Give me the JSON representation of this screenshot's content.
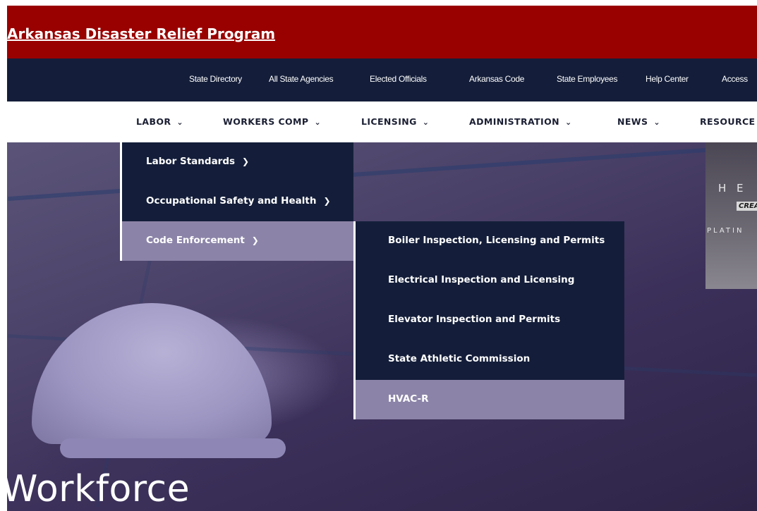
{
  "banner": {
    "link_text": "Arkansas Disaster Relief Program"
  },
  "utility_nav": [
    {
      "label": "State Directory"
    },
    {
      "label": "All State Agencies"
    },
    {
      "label": "Elected Officials"
    },
    {
      "label": "Arkansas Code"
    },
    {
      "label": "State Employees"
    },
    {
      "label": "Help Center"
    },
    {
      "label": "Access"
    }
  ],
  "main_nav": [
    {
      "label": "LABOR",
      "chevron": "chevron-down-icon"
    },
    {
      "label": "WORKERS COMP",
      "chevron": "chevron-down-icon"
    },
    {
      "label": "LICENSING",
      "chevron": "chevron-down-icon"
    },
    {
      "label": "ADMINISTRATION",
      "chevron": "chevron-down-icon"
    },
    {
      "label": "NEWS",
      "chevron": "chevron-down-icon"
    },
    {
      "label": "RESOURCE"
    }
  ],
  "labor_menu": [
    {
      "label": "Labor Standards",
      "chevron": "chevron-right-icon"
    },
    {
      "label": "Occupational Safety and Health",
      "chevron": "chevron-right-icon"
    },
    {
      "label": "Code Enforcement",
      "chevron": "chevron-right-icon",
      "active": true
    }
  ],
  "code_enforcement_menu": [
    {
      "label": "Boiler Inspection, Licensing and Permits"
    },
    {
      "label": "Electrical Inspection and Licensing"
    },
    {
      "label": "Elevator Inspection and Permits"
    },
    {
      "label": "State Athletic Commission"
    },
    {
      "label": "HVAC-R",
      "active": true
    }
  ],
  "hero": {
    "title": "Workforce"
  },
  "ad": {
    "line1": "H E",
    "line2": "CREA",
    "line3": "PLATIN"
  },
  "colors": {
    "banner_bg": "#990000",
    "nav_bg": "#141e3a",
    "menu_active_bg": "#8c84a8",
    "text_light": "#ffffff",
    "text_dark": "#1b1f33"
  }
}
